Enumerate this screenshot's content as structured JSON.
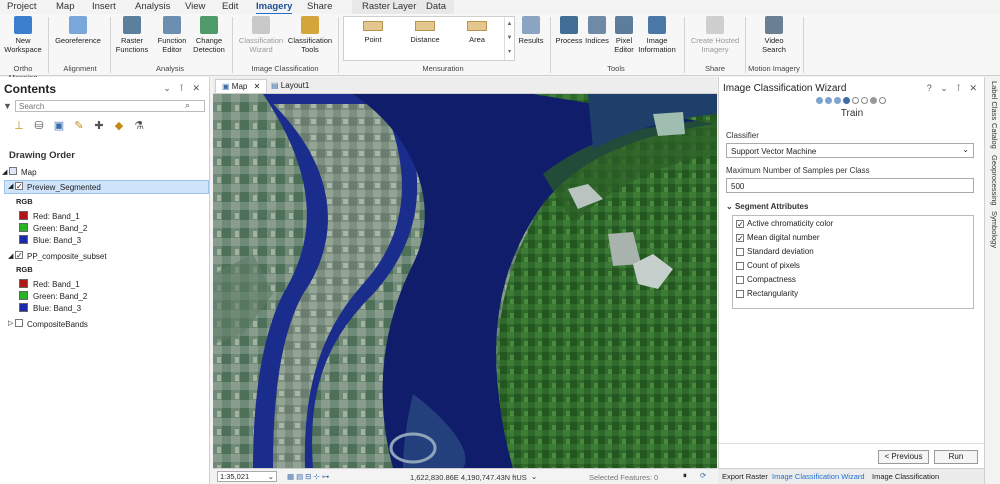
{
  "menubar": {
    "tabs": [
      "Project",
      "Map",
      "Insert",
      "Analysis",
      "View",
      "Edit",
      "Imagery",
      "Share"
    ],
    "active": "Imagery",
    "context_tabs": [
      "Raster Layer",
      "Data"
    ]
  },
  "ribbon": {
    "buttons": {
      "new_workspace": "New\nWorkspace",
      "georeference": "Georeference",
      "raster_functions": "Raster\nFunctions",
      "function_editor": "Function\nEditor",
      "change_detection": "Change\nDetection",
      "classification_wizard": "Classification\nWizard",
      "classification_tools": "Classification\nTools",
      "results": "Results",
      "process": "Process",
      "indices": "Indices",
      "pixel_editor": "Pixel\nEditor",
      "image_information": "Image\nInformation",
      "create_hosted_imagery": "Create Hosted\nImagery",
      "video_search": "Video\nSearch"
    },
    "mensuration": [
      "Point",
      "Distance",
      "Area"
    ],
    "groups": {
      "ortho": "Ortho Mapping",
      "alignment": "Alignment",
      "analysis": "Analysis",
      "image_classification": "Image Classification",
      "mensuration": "Mensuration",
      "tools": "Tools",
      "share": "Share",
      "motion": "Motion Imagery"
    }
  },
  "contents": {
    "title": "Contents",
    "search_placeholder": "Search",
    "drawing_order": "Drawing Order",
    "map": "Map",
    "layers": [
      {
        "name": "Preview_Segmented",
        "rgb": "RGB",
        "bands": [
          "Red:  Band_1",
          "Green: Band_2",
          "Blue:  Band_3"
        ],
        "checked": true
      },
      {
        "name": "PP_composite_subset",
        "rgb": "RGB",
        "bands": [
          "Red:  Band_1",
          "Green: Band_2",
          "Blue:  Band_3"
        ],
        "checked": true
      },
      {
        "name": "CompositeBands",
        "checked": false
      }
    ],
    "colors": {
      "red": "#b01818",
      "green": "#27b427",
      "blue": "#1a2aa8"
    }
  },
  "views": {
    "map_tab": "Map",
    "layout_tab": "Layout1"
  },
  "status": {
    "scale": "1:35,021",
    "coords": "1,622,830.86E 4,190,747.43N ftUS",
    "selected": "Selected Features: 0"
  },
  "wizard": {
    "title": "Image Classification Wizard",
    "step": "Train",
    "step_index": 4,
    "step_count": 7,
    "classifier_label": "Classifier",
    "classifier_value": "Support Vector Machine",
    "samples_label": "Maximum Number of Samples per Class",
    "samples_value": "500",
    "segment_title": "Segment Attributes",
    "attributes": [
      {
        "label": "Active chromaticity color",
        "checked": true
      },
      {
        "label": "Mean digital number",
        "checked": true
      },
      {
        "label": "Standard deviation",
        "checked": false
      },
      {
        "label": "Count of pixels",
        "checked": false
      },
      {
        "label": "Compactness",
        "checked": false
      },
      {
        "label": "Rectangularity",
        "checked": false
      }
    ],
    "prev": "< Previous",
    "run": "Run"
  },
  "right_rail": [
    "Label Class",
    "Catalog",
    "Geoprocessing",
    "Symbology"
  ],
  "bottom_tabs": [
    "Export Raster",
    "Image Classification Wizard",
    "Image Classification"
  ]
}
